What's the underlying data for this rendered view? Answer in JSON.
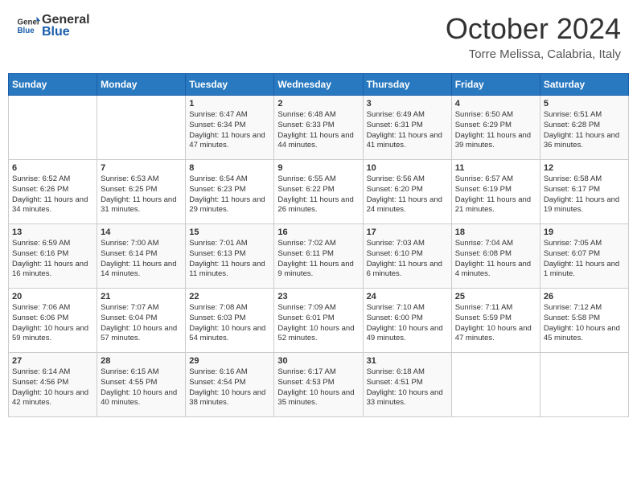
{
  "header": {
    "logo_line1": "General",
    "logo_line2": "Blue",
    "month": "October 2024",
    "location": "Torre Melissa, Calabria, Italy"
  },
  "weekdays": [
    "Sunday",
    "Monday",
    "Tuesday",
    "Wednesday",
    "Thursday",
    "Friday",
    "Saturday"
  ],
  "weeks": [
    [
      {
        "day": "",
        "sunrise": "",
        "sunset": "",
        "daylight": ""
      },
      {
        "day": "",
        "sunrise": "",
        "sunset": "",
        "daylight": ""
      },
      {
        "day": "1",
        "sunrise": "Sunrise: 6:47 AM",
        "sunset": "Sunset: 6:34 PM",
        "daylight": "Daylight: 11 hours and 47 minutes."
      },
      {
        "day": "2",
        "sunrise": "Sunrise: 6:48 AM",
        "sunset": "Sunset: 6:33 PM",
        "daylight": "Daylight: 11 hours and 44 minutes."
      },
      {
        "day": "3",
        "sunrise": "Sunrise: 6:49 AM",
        "sunset": "Sunset: 6:31 PM",
        "daylight": "Daylight: 11 hours and 41 minutes."
      },
      {
        "day": "4",
        "sunrise": "Sunrise: 6:50 AM",
        "sunset": "Sunset: 6:29 PM",
        "daylight": "Daylight: 11 hours and 39 minutes."
      },
      {
        "day": "5",
        "sunrise": "Sunrise: 6:51 AM",
        "sunset": "Sunset: 6:28 PM",
        "daylight": "Daylight: 11 hours and 36 minutes."
      }
    ],
    [
      {
        "day": "6",
        "sunrise": "Sunrise: 6:52 AM",
        "sunset": "Sunset: 6:26 PM",
        "daylight": "Daylight: 11 hours and 34 minutes."
      },
      {
        "day": "7",
        "sunrise": "Sunrise: 6:53 AM",
        "sunset": "Sunset: 6:25 PM",
        "daylight": "Daylight: 11 hours and 31 minutes."
      },
      {
        "day": "8",
        "sunrise": "Sunrise: 6:54 AM",
        "sunset": "Sunset: 6:23 PM",
        "daylight": "Daylight: 11 hours and 29 minutes."
      },
      {
        "day": "9",
        "sunrise": "Sunrise: 6:55 AM",
        "sunset": "Sunset: 6:22 PM",
        "daylight": "Daylight: 11 hours and 26 minutes."
      },
      {
        "day": "10",
        "sunrise": "Sunrise: 6:56 AM",
        "sunset": "Sunset: 6:20 PM",
        "daylight": "Daylight: 11 hours and 24 minutes."
      },
      {
        "day": "11",
        "sunrise": "Sunrise: 6:57 AM",
        "sunset": "Sunset: 6:19 PM",
        "daylight": "Daylight: 11 hours and 21 minutes."
      },
      {
        "day": "12",
        "sunrise": "Sunrise: 6:58 AM",
        "sunset": "Sunset: 6:17 PM",
        "daylight": "Daylight: 11 hours and 19 minutes."
      }
    ],
    [
      {
        "day": "13",
        "sunrise": "Sunrise: 6:59 AM",
        "sunset": "Sunset: 6:16 PM",
        "daylight": "Daylight: 11 hours and 16 minutes."
      },
      {
        "day": "14",
        "sunrise": "Sunrise: 7:00 AM",
        "sunset": "Sunset: 6:14 PM",
        "daylight": "Daylight: 11 hours and 14 minutes."
      },
      {
        "day": "15",
        "sunrise": "Sunrise: 7:01 AM",
        "sunset": "Sunset: 6:13 PM",
        "daylight": "Daylight: 11 hours and 11 minutes."
      },
      {
        "day": "16",
        "sunrise": "Sunrise: 7:02 AM",
        "sunset": "Sunset: 6:11 PM",
        "daylight": "Daylight: 11 hours and 9 minutes."
      },
      {
        "day": "17",
        "sunrise": "Sunrise: 7:03 AM",
        "sunset": "Sunset: 6:10 PM",
        "daylight": "Daylight: 11 hours and 6 minutes."
      },
      {
        "day": "18",
        "sunrise": "Sunrise: 7:04 AM",
        "sunset": "Sunset: 6:08 PM",
        "daylight": "Daylight: 11 hours and 4 minutes."
      },
      {
        "day": "19",
        "sunrise": "Sunrise: 7:05 AM",
        "sunset": "Sunset: 6:07 PM",
        "daylight": "Daylight: 11 hours and 1 minute."
      }
    ],
    [
      {
        "day": "20",
        "sunrise": "Sunrise: 7:06 AM",
        "sunset": "Sunset: 6:06 PM",
        "daylight": "Daylight: 10 hours and 59 minutes."
      },
      {
        "day": "21",
        "sunrise": "Sunrise: 7:07 AM",
        "sunset": "Sunset: 6:04 PM",
        "daylight": "Daylight: 10 hours and 57 minutes."
      },
      {
        "day": "22",
        "sunrise": "Sunrise: 7:08 AM",
        "sunset": "Sunset: 6:03 PM",
        "daylight": "Daylight: 10 hours and 54 minutes."
      },
      {
        "day": "23",
        "sunrise": "Sunrise: 7:09 AM",
        "sunset": "Sunset: 6:01 PM",
        "daylight": "Daylight: 10 hours and 52 minutes."
      },
      {
        "day": "24",
        "sunrise": "Sunrise: 7:10 AM",
        "sunset": "Sunset: 6:00 PM",
        "daylight": "Daylight: 10 hours and 49 minutes."
      },
      {
        "day": "25",
        "sunrise": "Sunrise: 7:11 AM",
        "sunset": "Sunset: 5:59 PM",
        "daylight": "Daylight: 10 hours and 47 minutes."
      },
      {
        "day": "26",
        "sunrise": "Sunrise: 7:12 AM",
        "sunset": "Sunset: 5:58 PM",
        "daylight": "Daylight: 10 hours and 45 minutes."
      }
    ],
    [
      {
        "day": "27",
        "sunrise": "Sunrise: 6:14 AM",
        "sunset": "Sunset: 4:56 PM",
        "daylight": "Daylight: 10 hours and 42 minutes."
      },
      {
        "day": "28",
        "sunrise": "Sunrise: 6:15 AM",
        "sunset": "Sunset: 4:55 PM",
        "daylight": "Daylight: 10 hours and 40 minutes."
      },
      {
        "day": "29",
        "sunrise": "Sunrise: 6:16 AM",
        "sunset": "Sunset: 4:54 PM",
        "daylight": "Daylight: 10 hours and 38 minutes."
      },
      {
        "day": "30",
        "sunrise": "Sunrise: 6:17 AM",
        "sunset": "Sunset: 4:53 PM",
        "daylight": "Daylight: 10 hours and 35 minutes."
      },
      {
        "day": "31",
        "sunrise": "Sunrise: 6:18 AM",
        "sunset": "Sunset: 4:51 PM",
        "daylight": "Daylight: 10 hours and 33 minutes."
      },
      {
        "day": "",
        "sunrise": "",
        "sunset": "",
        "daylight": ""
      },
      {
        "day": "",
        "sunrise": "",
        "sunset": "",
        "daylight": ""
      }
    ]
  ]
}
